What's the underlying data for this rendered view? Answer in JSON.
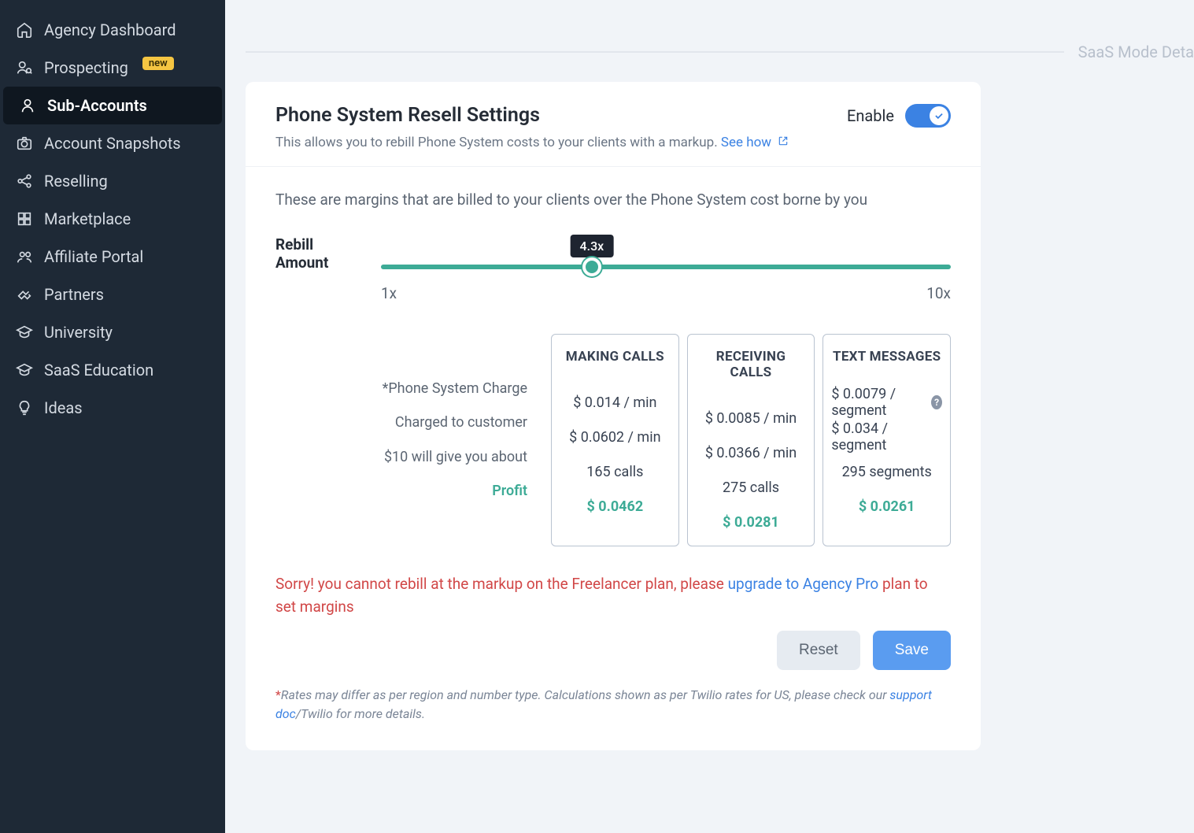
{
  "sidebar": {
    "items": [
      {
        "label": "Agency Dashboard",
        "icon": "home"
      },
      {
        "label": "Prospecting",
        "icon": "user-search",
        "badge": "new"
      },
      {
        "label": "Sub-Accounts",
        "icon": "user",
        "active": true
      },
      {
        "label": "Account Snapshots",
        "icon": "camera"
      },
      {
        "label": "Reselling",
        "icon": "share"
      },
      {
        "label": "Marketplace",
        "icon": "grid"
      },
      {
        "label": "Affiliate Portal",
        "icon": "users"
      },
      {
        "label": "Partners",
        "icon": "handshake"
      },
      {
        "label": "University",
        "icon": "graduation"
      },
      {
        "label": "SaaS Education",
        "icon": "graduation"
      },
      {
        "label": "Ideas",
        "icon": "bulb"
      }
    ]
  },
  "section_label": "SaaS Mode Deta",
  "card": {
    "title": "Phone System Resell Settings",
    "description": "This allows you to rebill Phone System costs to your clients with a markup.",
    "see_how": "See how",
    "enable_label": "Enable",
    "margin_desc": "These are margins that are billed to your clients over the Phone System cost borne by you",
    "slider": {
      "label": "Rebill Amount",
      "min_label": "1x",
      "max_label": "10x",
      "value_label": "4.3x",
      "percent": 37
    },
    "row_labels": {
      "charge": "*Phone System Charge",
      "customer": "Charged to customer",
      "ten_dollar": "$10 will give you about",
      "profit": "Profit"
    },
    "columns": [
      {
        "title": "MAKING CALLS",
        "charge": "$ 0.014 / min",
        "customer": "$ 0.0602 / min",
        "ten_dollar": "165 calls",
        "profit": "$ 0.0462"
      },
      {
        "title": "RECEIVING CALLS",
        "charge": "$ 0.0085 / min",
        "customer": "$ 0.0366 / min",
        "ten_dollar": "275 calls",
        "profit": "$ 0.0281"
      },
      {
        "title": "TEXT MESSAGES",
        "charge": "$ 0.0079 / segment",
        "customer": "$ 0.034 / segment",
        "ten_dollar": "295 segments",
        "profit": "$ 0.0261",
        "help": true
      }
    ],
    "warning": {
      "prefix": "Sorry! you cannot rebill at the markup on the Freelancer plan, please ",
      "link": "upgrade to Agency Pro",
      "suffix": " plan to set margins"
    },
    "reset_label": "Reset",
    "save_label": "Save",
    "footnote": {
      "text": "Rates may differ as per region and number type. Calculations shown as per Twilio rates for US, please check our ",
      "link": "support doc",
      "suffix": "/Twilio for more details."
    }
  }
}
